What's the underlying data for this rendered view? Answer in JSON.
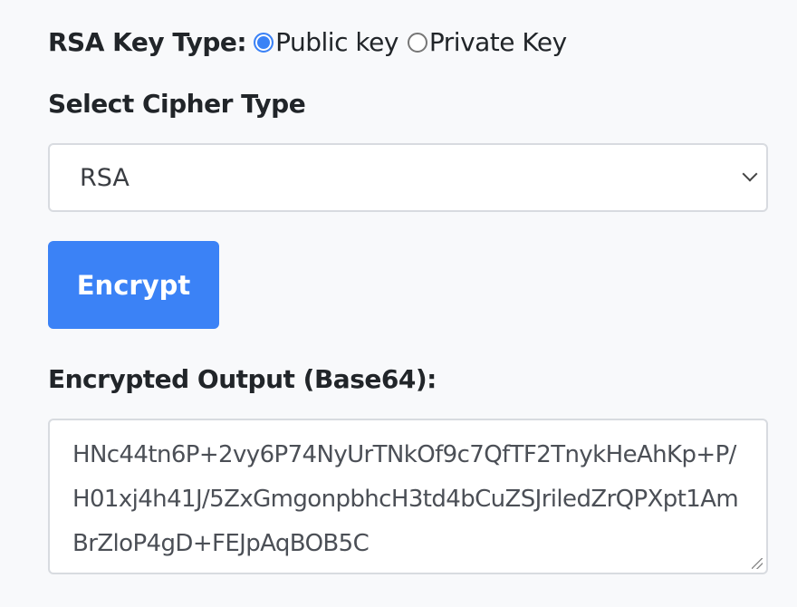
{
  "key_type": {
    "label": "RSA Key Type:",
    "options": [
      {
        "label": "Public key",
        "selected": true
      },
      {
        "label": "Private Key",
        "selected": false
      }
    ]
  },
  "cipher": {
    "label": "Select Cipher Type",
    "selected": "RSA"
  },
  "encrypt_button": "Encrypt",
  "output": {
    "label": "Encrypted Output (Base64):",
    "value": "HNc44tn6P+2vy6P74NyUrTNkOf9c7QfTF2TnykHeAhKp+P/H01xj4h41J/5ZxGmgonpbhcH3td4bCuZSJriledZrQPXpt1AmBrZloP4gD+FEJpAqBOB5C"
  },
  "colors": {
    "accent": "#3b82f6",
    "background": "#f8f9fb"
  }
}
